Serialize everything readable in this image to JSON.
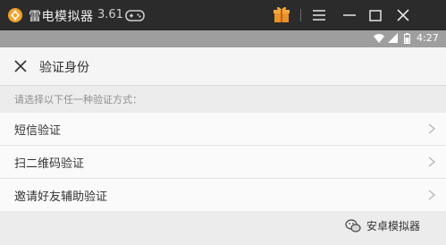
{
  "window": {
    "app_name": "雷电模拟器",
    "version": "3.61",
    "icons": [
      "logo-icon",
      "gamepad-icon",
      "gift-icon",
      "menu-icon",
      "minimize-icon",
      "maximize-icon",
      "close-icon"
    ],
    "accent": "#f0a12c"
  },
  "statusbar": {
    "time": "4:27",
    "icons": [
      "wifi-icon",
      "signal-icon",
      "battery-icon"
    ]
  },
  "page": {
    "title": "验证身份",
    "back_icon": "close-icon"
  },
  "verification": {
    "hint": "请选择以下任一种验证方式：",
    "options": [
      {
        "label": "短信验证"
      },
      {
        "label": "扫二维码验证"
      },
      {
        "label": "邀请好友辅助验证"
      }
    ]
  },
  "watermark": {
    "text": "安卓模拟器",
    "icon": "wechat-icon"
  }
}
